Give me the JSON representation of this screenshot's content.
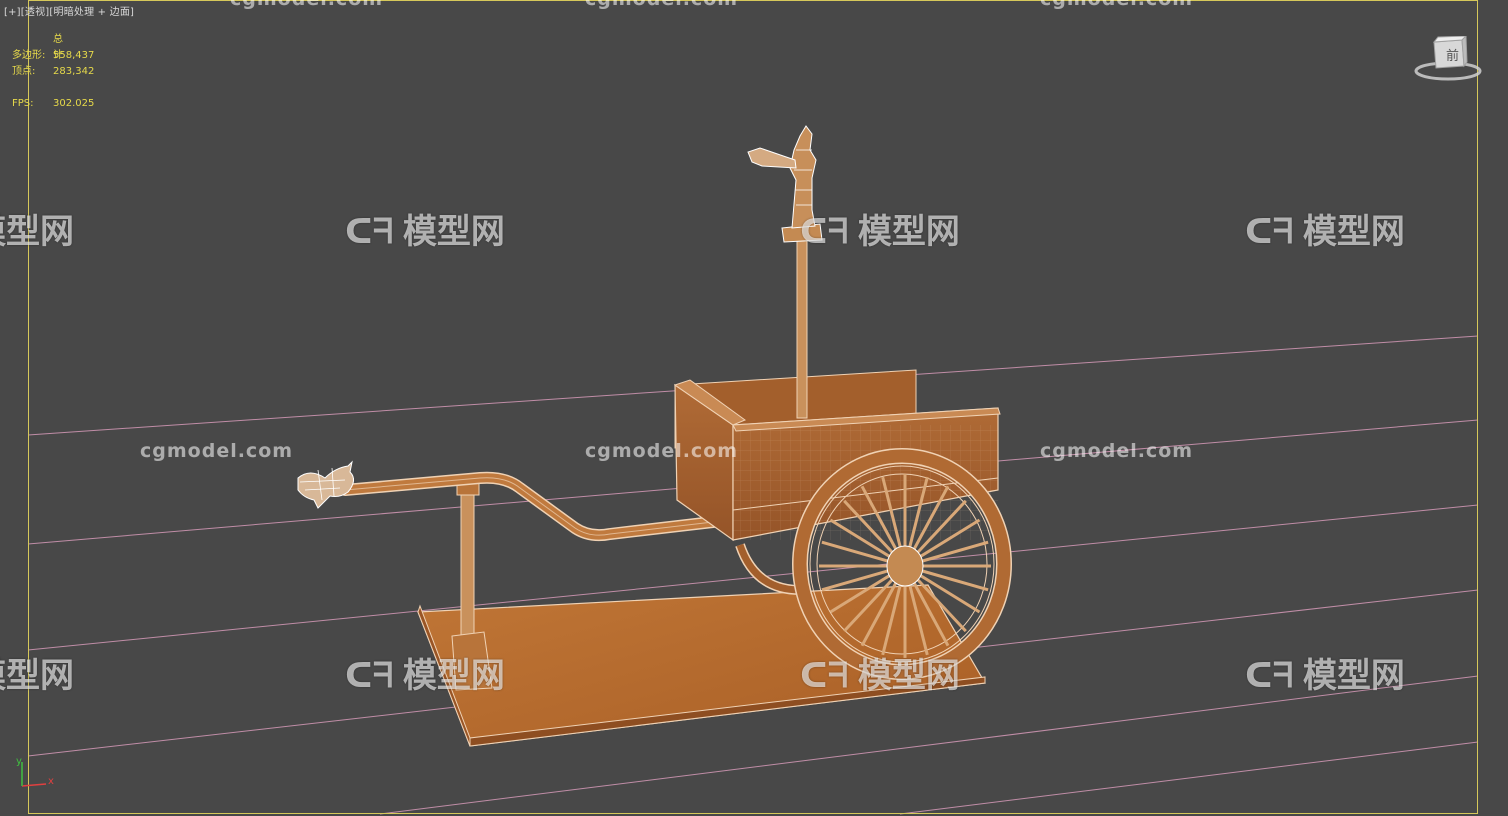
{
  "viewport": {
    "label_parts": [
      "[+]",
      "[透视]",
      "[明暗处理 + 边面]"
    ]
  },
  "stats": {
    "header": "总计",
    "rows": [
      {
        "key": "多边形:",
        "value": "558,437"
      },
      {
        "key": "顶点:",
        "value": "283,342"
      },
      {
        "key": "FPS:",
        "value": "302.025"
      }
    ]
  },
  "viewcube": {
    "face_label": "前"
  },
  "watermark": {
    "site": "cgmodel.com",
    "brand": "模型网",
    "logo": "ᑕᖷ"
  },
  "axis": {
    "x_label": "x",
    "y_label": "y"
  },
  "colors": {
    "background": "#484848",
    "stats_text": "#e6d94a",
    "viewport_border": "#d6c85a",
    "grid_line": "#d69ab8",
    "wood": "#b86e34",
    "wire": "#f0d2b4"
  }
}
